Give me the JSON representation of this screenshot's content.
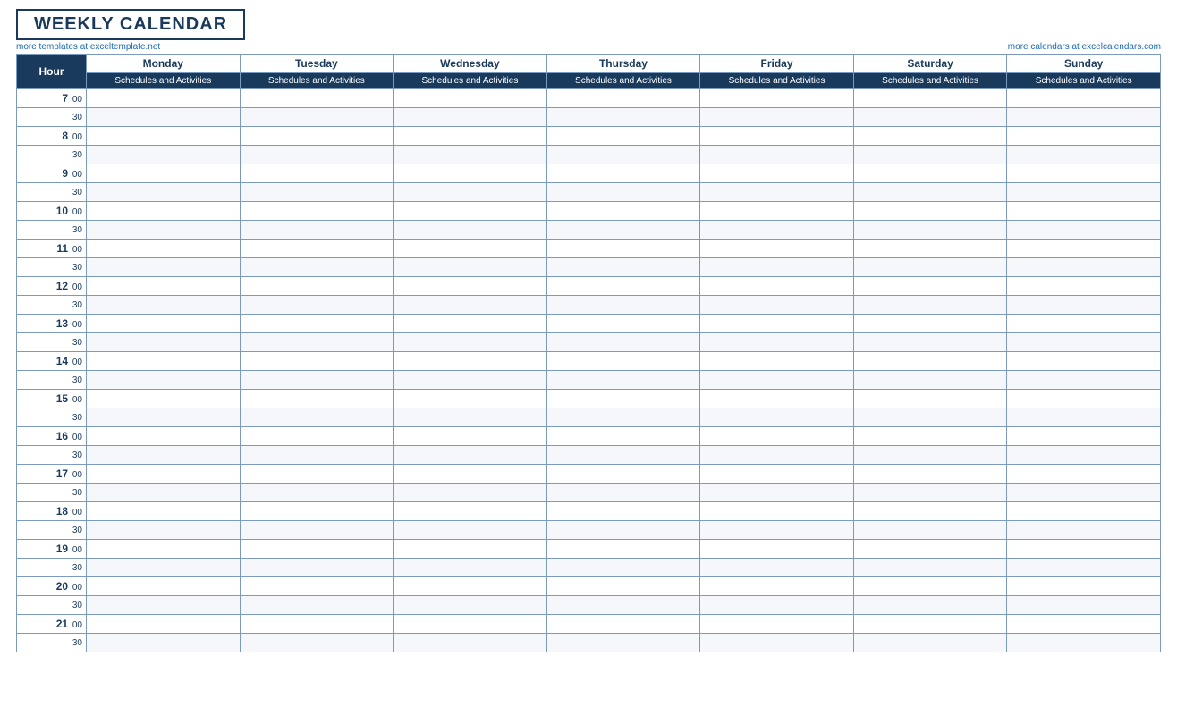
{
  "title": "WEEKLY CALENDAR",
  "link_left": "more templates at exceltemplate.net",
  "link_right": "more calendars at excelcalendars.com",
  "header": {
    "hour_label": "Hour",
    "days": [
      {
        "label": "Monday",
        "sub": "Schedules and Activities"
      },
      {
        "label": "Tuesday",
        "sub": "Schedules and Activities"
      },
      {
        "label": "Wednesday",
        "sub": "Schedules and Activities"
      },
      {
        "label": "Thursday",
        "sub": "Schedules and Activities"
      },
      {
        "label": "Friday",
        "sub": "Schedules and Activities"
      },
      {
        "label": "Saturday",
        "sub": "Schedules and Activities"
      },
      {
        "label": "Sunday",
        "sub": "Schedules and Activities"
      }
    ]
  },
  "hours": [
    {
      "num": "7",
      "min": "00"
    },
    {
      "num": "",
      "min": "30"
    },
    {
      "num": "8",
      "min": "00"
    },
    {
      "num": "",
      "min": "30"
    },
    {
      "num": "9",
      "min": "00"
    },
    {
      "num": "",
      "min": "30"
    },
    {
      "num": "10",
      "min": "00"
    },
    {
      "num": "",
      "min": "30"
    },
    {
      "num": "11",
      "min": "00"
    },
    {
      "num": "",
      "min": "30"
    },
    {
      "num": "12",
      "min": "00"
    },
    {
      "num": "",
      "min": "30"
    },
    {
      "num": "13",
      "min": "00"
    },
    {
      "num": "",
      "min": "30"
    },
    {
      "num": "14",
      "min": "00"
    },
    {
      "num": "",
      "min": "30"
    },
    {
      "num": "15",
      "min": "00"
    },
    {
      "num": "",
      "min": "30"
    },
    {
      "num": "16",
      "min": "00"
    },
    {
      "num": "",
      "min": "30"
    },
    {
      "num": "17",
      "min": "00"
    },
    {
      "num": "",
      "min": "30"
    },
    {
      "num": "18",
      "min": "00"
    },
    {
      "num": "",
      "min": "30"
    },
    {
      "num": "19",
      "min": "00"
    },
    {
      "num": "",
      "min": "30"
    },
    {
      "num": "20",
      "min": "00"
    },
    {
      "num": "",
      "min": "30"
    },
    {
      "num": "21",
      "min": "00"
    },
    {
      "num": "",
      "min": "30"
    }
  ]
}
